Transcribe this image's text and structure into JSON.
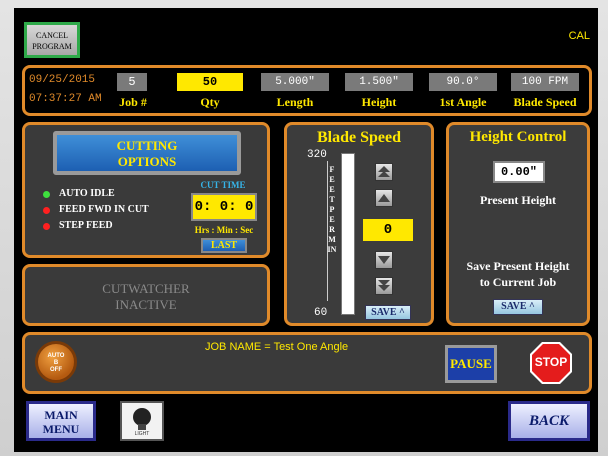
{
  "header": {
    "cancel_label_1": "CANCEL",
    "cancel_label_2": "PROGRAM",
    "cal": "CAL"
  },
  "job_info": {
    "date": "09/25/2015",
    "time": "07:37:27 AM",
    "job_value": "5",
    "job_label": "Job #",
    "qty_value": "50",
    "qty_label": "Qty",
    "length_value": "5.000\"",
    "length_label": "Length",
    "height_value": "1.500\"",
    "height_label": "Height",
    "angle_value": "90.0°",
    "angle_label": "1st Angle",
    "speed_value": "100 FPM",
    "speed_label": "Blade Speed"
  },
  "cutting": {
    "button_line1": "CUTTING",
    "button_line2": "OPTIONS",
    "options": [
      "AUTO IDLE",
      "FEED FWD IN CUT",
      "STEP FEED"
    ],
    "option_colors": [
      "#3ee03e",
      "#ff2020",
      "#ff2020"
    ],
    "cut_time_label": "CUT TIME",
    "cut_time_value": "0: 0: 0",
    "time_units": "Hrs : Min : Sec",
    "last_label": "LAST"
  },
  "cutwatcher": {
    "line1": "CUTWATCHER",
    "line2": "INACTIVE"
  },
  "blade_speed": {
    "title": "Blade Speed",
    "max": "320",
    "min": "60",
    "scale_text": "FEET PER MIN",
    "value": "0",
    "save_label": "SAVE ^",
    "level": 0
  },
  "height_control": {
    "title": "Height Control",
    "value": "0.00\"",
    "present_label": "Present Height",
    "save_text_1": "Save Present Height",
    "save_text_2": "to Current Job",
    "save_label": "SAVE ^"
  },
  "bottom_bar": {
    "auto_label_1": "AUTO",
    "auto_label_2": "B",
    "auto_label_3": "OFF",
    "job_name": "JOB NAME = Test One Angle",
    "pause_label": "PAUSE",
    "stop_label": "STOP"
  },
  "footer": {
    "main_menu_1": "MAIN",
    "main_menu_2": "MENU",
    "light_label": "LIGHT",
    "back_label": "BACK"
  },
  "colors": {
    "accent_orange": "#e08a2a",
    "value_yellow": "#ffe800",
    "pause_blue": "#1c3fa8",
    "stop_red": "#e41c1c"
  }
}
